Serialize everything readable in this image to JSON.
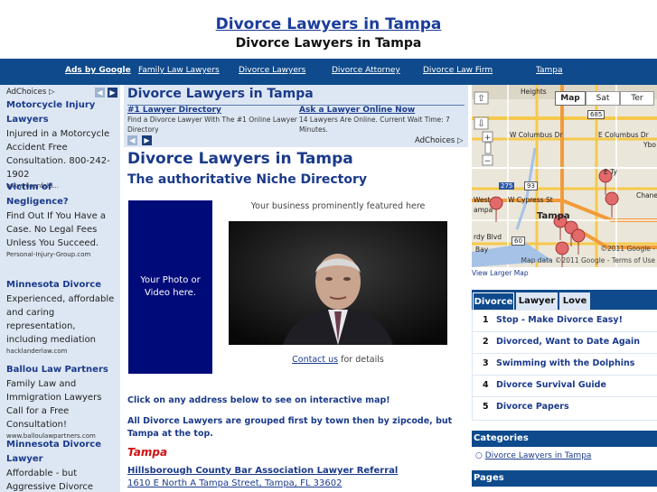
{
  "header": {
    "title": "Divorce Lawyers in Tampa",
    "subtitle": "Divorce Lawyers in Tampa"
  },
  "nav": {
    "ads_label": "Ads by Google",
    "links": [
      "Family Law Lawyers",
      "Divorce Lawyers",
      "Divorce Attorney",
      "Divorce Law Firm",
      "Tampa"
    ]
  },
  "left_ads": {
    "adchoices": "AdChoices",
    "items": [
      {
        "title": "Motorcycle Injury Lawyers",
        "desc": "Injured in a Motorcycle Accident Free Consultation. 800-242-1902",
        "url": "www.rosenfeld..."
      },
      {
        "title": "Victim of Negligence?",
        "desc": "Find Out If You Have a Case. No Legal Fees Unless You Succeed.",
        "url": "Personal-Injury-Group.com"
      },
      {
        "title": "Minnesota Divorce",
        "desc": "Experienced, affordable and caring representation, including mediation",
        "url": "hacklanderlaw.com"
      },
      {
        "title": "Ballou Law Partners",
        "desc": "Family Law and Immigration Lawyers Call for a Free Consultation!",
        "url": "www.balloulawpartners.com"
      },
      {
        "title": "Minnesota Divorce Lawyer",
        "desc": "Affordable - but Aggressive Divorce",
        "url": ""
      }
    ]
  },
  "center_ad": {
    "title": "Divorce Lawyers in Tampa",
    "ads": [
      {
        "title": "#1 Lawyer Directory",
        "body": "Find a Divorce Lawyer With The #1 Online Lawyer Directory"
      },
      {
        "title": "Ask a Lawyer Online Now",
        "body": "14 Lawyers Are Online. Current Wait Time: 7 Minutes."
      }
    ],
    "adchoices": "AdChoices"
  },
  "main": {
    "heading": "Divorce Lawyers in Tampa",
    "subheading": "The authoritative Niche Directory",
    "photo_text": "Your Photo or Video here.",
    "featured_text": "Your business prominently featured here",
    "contact_link": "Contact us",
    "contact_suffix": " for details",
    "click_text": "Click on any address below to see on interactive map!",
    "group_text": "All Divorce Lawyers are grouped first by town then by zipcode, but Tampa at the top.",
    "town": "Tampa",
    "lawyer_name": "Hillsborough County Bar Association Lawyer Referral",
    "lawyer_address": "1610 E North A Tampa Street, Tampa, FL 33602"
  },
  "map": {
    "type_buttons": [
      "Map",
      "Sat",
      "Ter"
    ],
    "labels": [
      "Heights",
      "W Columbus Dr",
      "E Columbus Dr",
      "W Cypress St",
      "Tampa",
      "West",
      "ampa",
      "Chanel",
      "Ybo",
      "685",
      "93",
      "60",
      "275",
      "E Ty",
      "rdy Blvd",
      "Bay"
    ],
    "credit1": "©2011 Google -",
    "credit2": "Map data ©2011 Google - Terms of Use",
    "larger_link": "View Larger Map"
  },
  "sidebar": {
    "tabs": [
      "Divorce",
      "Lawyer",
      "Love"
    ],
    "list": [
      {
        "n": "1",
        "label": "Stop - Make Divorce Easy!"
      },
      {
        "n": "2",
        "label": "Divorced, Want to Date Again"
      },
      {
        "n": "3",
        "label": "Swimming with the Dolphins"
      },
      {
        "n": "4",
        "label": "Divorce Survival Guide"
      },
      {
        "n": "5",
        "label": "Divorce Papers"
      }
    ],
    "categories_title": "Categories",
    "category_item": "Divorce Lawyers in Tampa",
    "pages_title": "Pages"
  }
}
